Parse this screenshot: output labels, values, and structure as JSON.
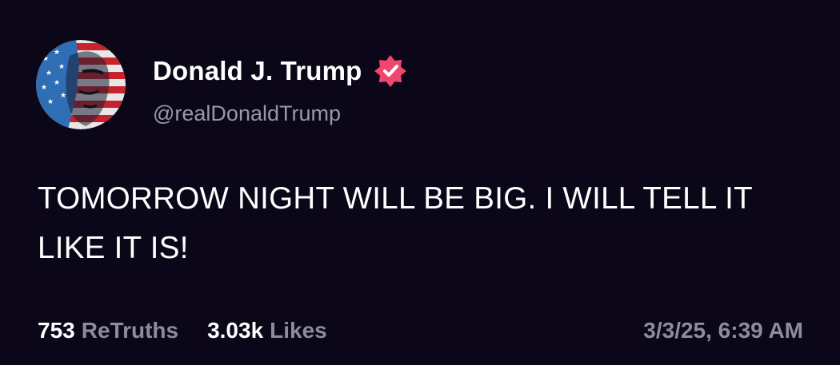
{
  "post": {
    "author": {
      "display_name": "Donald J. Trump",
      "handle": "@realDonaldTrump",
      "verified": true,
      "avatar_icon": "flag-portrait-avatar",
      "verified_icon": "verified-badge-icon"
    },
    "text": "TOMORROW NIGHT WILL BE BIG. I WILL TELL IT LIKE IT IS!",
    "stats": {
      "retruths_count": "753",
      "retruths_label": "ReTruths",
      "likes_count": "3.03k",
      "likes_label": "Likes"
    },
    "timestamp": "3/3/25, 6:39 AM"
  },
  "colors": {
    "background": "#0b0719",
    "text_primary": "#ffffff",
    "text_secondary": "#8e8c9c",
    "verified_badge": "#f0476e"
  }
}
